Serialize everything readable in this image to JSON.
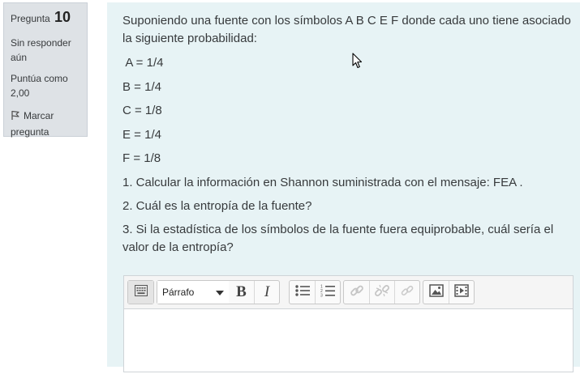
{
  "info": {
    "question_label": "Pregunta",
    "question_number": "10",
    "state": "Sin responder aún",
    "grade": "Puntúa como 2,00",
    "flag_label": "Marcar pregunta",
    "flag_icon": "flag-icon"
  },
  "question": {
    "intro": "Suponiendo una fuente con los símbolos A B C E F  donde cada uno tiene asociado la siguiente probabilidad:",
    "probabilities": [
      " A = 1/4",
      "B = 1/4",
      "C = 1/8",
      "E = 1/4",
      "F = 1/8"
    ],
    "items": [
      "1. Calcular la información en Shannon suministrada con el mensaje: FEA .",
      "2. Cuál es la entropía de la fuente?",
      "3. Si la estadística de los símbolos de la fuente fuera equiprobable, cuál sería el valor de la entropía?"
    ]
  },
  "editor": {
    "format_select": "Párrafo",
    "bold_label": "B",
    "italic_label": "I",
    "toolbar_icons": [
      "toolbar-toggle-icon",
      "unordered-list-icon",
      "ordered-list-icon",
      "link-icon",
      "unlink-icon",
      "anchor-icon",
      "image-icon",
      "media-icon"
    ]
  },
  "colors": {
    "panel_bg": "#e7f3f5",
    "info_bg": "#dee2e6"
  }
}
